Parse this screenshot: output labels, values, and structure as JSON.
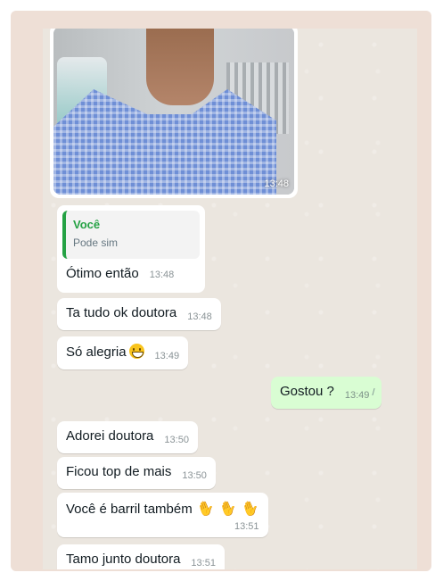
{
  "photo": {
    "time": "13:48"
  },
  "quoted_reply": {
    "author": "Você",
    "quoted_text": "Pode sim",
    "text": "Ótimo então",
    "time": "13:48"
  },
  "messages": [
    {
      "id": "m1",
      "direction": "in",
      "text": "Ta tudo ok doutora",
      "time": "13:48"
    },
    {
      "id": "m2",
      "direction": "in",
      "text": "Só alegria",
      "emoji": "grinning-face",
      "time": "13:49"
    },
    {
      "id": "m3",
      "direction": "out",
      "text": "Gostou ?",
      "time": "13:49",
      "status": "read-ticks"
    },
    {
      "id": "m4",
      "direction": "in",
      "text": "Adorei doutora",
      "time": "13:50"
    },
    {
      "id": "m5",
      "direction": "in",
      "text": "Ficou top de mais",
      "time": "13:50"
    },
    {
      "id": "m6",
      "direction": "in",
      "text": "Você é barril também",
      "emoji": "clapping-hands",
      "time": "13:51"
    },
    {
      "id": "m7",
      "direction": "in",
      "text": "Tamo junto doutora",
      "time": "13:51"
    }
  ],
  "colors": {
    "incoming_bubble": "#ffffff",
    "outgoing_bubble": "#d9fdd3",
    "quote_accent": "#25a244",
    "chat_background": "#ebe6df",
    "frame_background": "#eedfd6"
  }
}
